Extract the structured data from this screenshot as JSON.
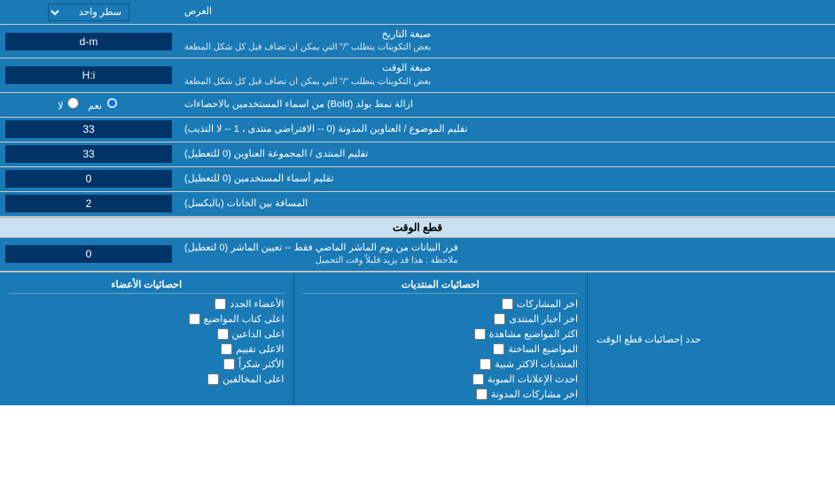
{
  "header": {
    "title": "العرض"
  },
  "rows": [
    {
      "id": "display-mode",
      "label": "العرض",
      "input_type": "select",
      "value": "سطر واحد"
    },
    {
      "id": "date-format",
      "label_main": "صيغة التاريخ",
      "label_sub": "بعض التكوينات يتطلب \"/\" التي يمكن ان تضاف قبل كل شكل المطعة",
      "input_type": "text",
      "value": "d-m"
    },
    {
      "id": "time-format",
      "label_main": "صيغة الوقت",
      "label_sub": "بعض التكوينات يتطلب \"/\" التي يمكن ان تضاف قبل كل شكل المطعة",
      "input_type": "text",
      "value": "H:i"
    },
    {
      "id": "remove-bold",
      "label": "ازالة نمط بولد (Bold) من اسماء المستخدمين بالاحصاءات",
      "input_type": "radio",
      "options": [
        "نعم",
        "لا"
      ],
      "selected": "نعم"
    },
    {
      "id": "sort-subject",
      "label": "تقليم الموضوع / العناوين المدونة (0 -- الافتراضي منتدى ، 1 -- لا التذيب)",
      "input_type": "text",
      "value": "33"
    },
    {
      "id": "sort-forum",
      "label": "تقليم المنتدى / المجموعة العناوين (0 للتعطيل)",
      "input_type": "text",
      "value": "33"
    },
    {
      "id": "sort-users",
      "label": "تقليم أسماء المستخدمين (0 للتعطيل)",
      "input_type": "text",
      "value": "0"
    },
    {
      "id": "space-entries",
      "label": "المسافة بين الخانات (بالبكسل)",
      "input_type": "text",
      "value": "2"
    }
  ],
  "section_cutoff": {
    "title": "قطع الوقت",
    "row": {
      "label_main": "فرز البيانات من يوم الماشر الماضي فقط -- تعيين الماشر (0 لتعطيل)",
      "label_sub": "ملاحظة : هذا قد يزيد قليلاً وقت التحميل",
      "input_type": "text",
      "value": "0"
    }
  },
  "bottom": {
    "label": "حدد إحصائيات قطع الوقت",
    "col1_header": "احصائيات المنتديات",
    "col1_items": [
      "اخر المشاركات",
      "اخر أخبار المنتدى",
      "اكثر المواضيع مشاهدة",
      "المواضيع الساخنة",
      "المنتديات الاكثر شبية",
      "احدث الإعلانات المبوبة",
      "اخر مشاركات المدونة"
    ],
    "col2_header": "احصائيات الأعضاء",
    "col2_items": [
      "الأعضاء الجدد",
      "اعلى كتاب المواضيع",
      "اعلى الداعين",
      "الاعلى تقييم",
      "الأكثر شكراً",
      "اعلى المخالفين"
    ]
  }
}
